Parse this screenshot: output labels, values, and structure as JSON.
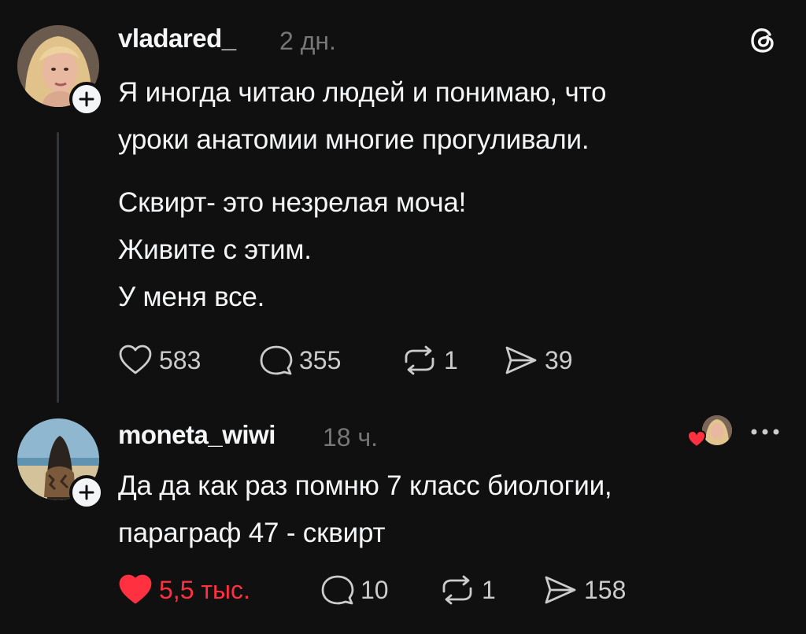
{
  "posts": [
    {
      "username": "vladared_",
      "time": "2 дн.",
      "lines": [
        "Я иногда читаю людей и понимаю, что",
        "уроки анатомии многие прогуливали.",
        "Сквирт- это незрелая моча!",
        "Живите с этим.",
        "У меня все."
      ],
      "likes": "583",
      "comments": "355",
      "reposts": "1",
      "shares": "39"
    },
    {
      "username": "moneta_wiwi",
      "time": "18 ч.",
      "lines": [
        "Да да как раз помню 7 класс биологии,",
        "параграф 47 - сквирт"
      ],
      "likes": "5,5 тыс.",
      "comments": "10",
      "reposts": "1",
      "shares": "158"
    }
  ],
  "icons": {
    "app_logo": "threads-logo-icon",
    "more": "more-horizontal-icon",
    "heart": "heart-icon",
    "comment": "comment-icon",
    "repost": "repost-icon",
    "share": "share-icon",
    "follow": "plus-icon"
  },
  "colors": {
    "background": "#101010",
    "text": "#f3f5f7",
    "muted": "#777777",
    "like_active": "#ff3040"
  }
}
